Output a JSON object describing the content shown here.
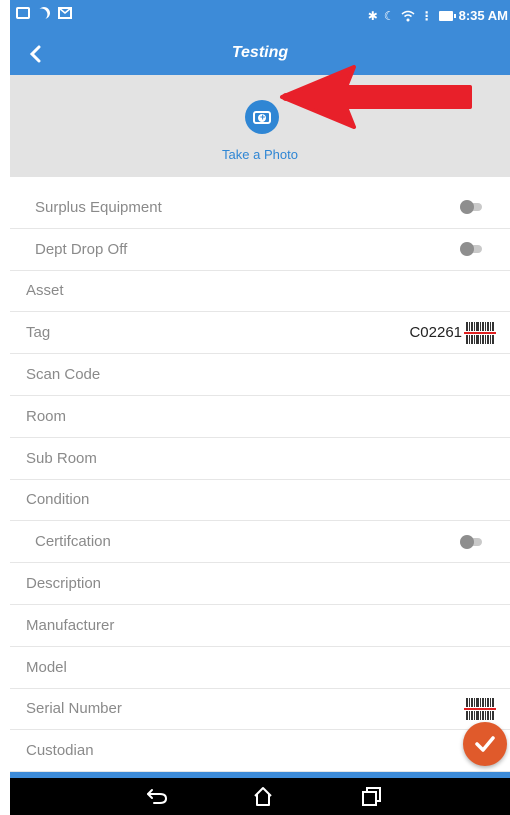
{
  "statusbar": {
    "time": "8:35 AM",
    "icons": [
      "screen-icon",
      "moon-icon",
      "mail-icon",
      "bluetooth-icon",
      "do-not-disturb-icon",
      "wifi-icon",
      "battery-icon"
    ]
  },
  "appbar": {
    "title": "Testing",
    "back_icon": "chevron-left-icon"
  },
  "photo": {
    "label": "Take a Photo",
    "icon": "camera-icon"
  },
  "form": {
    "surplus_equipment": {
      "label": "Surplus Equipment",
      "toggle_on": false
    },
    "dept_drop_off": {
      "label": "Dept Drop Off",
      "toggle_on": false
    },
    "asset": {
      "label": "Asset",
      "value": ""
    },
    "tag": {
      "label": "Tag",
      "value": "C02261"
    },
    "scan_code": {
      "label": "Scan Code",
      "value": ""
    },
    "room": {
      "label": "Room",
      "value": ""
    },
    "sub_room": {
      "label": "Sub Room",
      "value": ""
    },
    "condition": {
      "label": "Condition",
      "value": ""
    },
    "certification": {
      "label": "Certifcation",
      "toggle_on": false
    },
    "description": {
      "label": "Description",
      "value": ""
    },
    "manufacturer": {
      "label": "Manufacturer",
      "value": ""
    },
    "model": {
      "label": "Model",
      "value": ""
    },
    "serial_number": {
      "label": "Serial Number",
      "value": ""
    },
    "custodian": {
      "label": "Custodian",
      "value": ""
    }
  },
  "fab": {
    "icon": "checkmark-icon"
  },
  "navbar": {
    "icons": [
      "back-icon",
      "home-icon",
      "recent-apps-icon"
    ]
  },
  "colors": {
    "primary": "#3d8bd8",
    "accent": "#e05a2b",
    "annotation": "#e8202a",
    "photo_bg": "#e3e3e3"
  }
}
